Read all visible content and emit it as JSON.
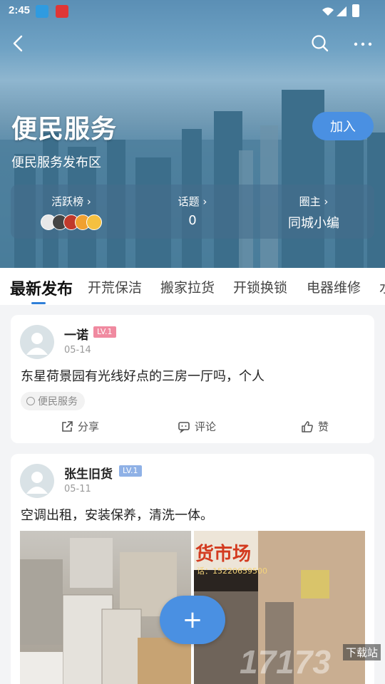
{
  "status_bar": {
    "time": "2:45"
  },
  "header": {
    "title": "便民服务",
    "description": "便民服务发布区",
    "join_label": "加入"
  },
  "stats": {
    "active": {
      "label": "活跃榜"
    },
    "topics": {
      "label": "话题",
      "value": "0"
    },
    "owner": {
      "label": "圈主",
      "value": "同城小编"
    }
  },
  "tabs": [
    {
      "label": "最新发布",
      "active": true
    },
    {
      "label": "开荒保洁"
    },
    {
      "label": "搬家拉货"
    },
    {
      "label": "开锁换锁"
    },
    {
      "label": "电器维修"
    },
    {
      "label": "水"
    }
  ],
  "posts": [
    {
      "author": "一诺",
      "level": "LV.1",
      "level_color": "#f08aa0",
      "date": "05-14",
      "content": "东星荷景园有光线好点的三房一厅吗，个人",
      "tag": "便民服务",
      "actions": {
        "share": "分享",
        "comment": "评论",
        "like": "赞"
      }
    },
    {
      "author": "张生旧货",
      "level": "LV.1",
      "level_color": "#8fb1e6",
      "date": "05-11",
      "content": "空调出租，安装保养，清洗一体。",
      "photo_signs": {
        "shop_name": "货市场",
        "phone": "话：15220659500"
      }
    }
  ],
  "fab": {
    "label": "+"
  },
  "watermark": {
    "text": "下载站",
    "brand": "17173"
  },
  "colors": {
    "accent": "#4a90e2",
    "tab_indicator": "#2f7fd8"
  }
}
